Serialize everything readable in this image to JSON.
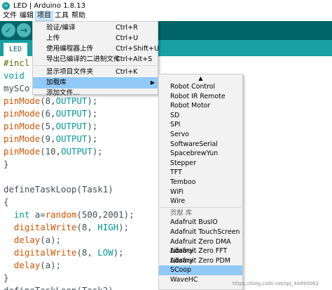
{
  "window": {
    "title": "LED | Arduino 1.8.13",
    "app_icon_glyph": "∞"
  },
  "menubar": {
    "items": [
      "文件",
      "编辑",
      "项目",
      "工具",
      "帮助"
    ],
    "active_index": 2
  },
  "toolbar": {
    "verify_glyph": "✓",
    "upload_glyph": "→"
  },
  "tabs": {
    "items": [
      "LED"
    ]
  },
  "editor": {
    "lines": [
      [
        {
          "t": "#incl",
          "c": "kw-pp"
        }
      ],
      [
        {
          "t": "void",
          "c": "kw-teal"
        }
      ],
      [
        {
          "t": "mySCo",
          "c": ""
        }
      ],
      [
        {
          "t": "pinMode",
          "c": "kw-orange"
        },
        {
          "t": "(8,",
          "c": ""
        },
        {
          "t": "OUTPUT",
          "c": "kw-teal"
        },
        {
          "t": ");",
          "c": ""
        }
      ],
      [
        {
          "t": "pinMode",
          "c": "kw-orange"
        },
        {
          "t": "(6,",
          "c": ""
        },
        {
          "t": "OUTPUT",
          "c": "kw-teal"
        },
        {
          "t": ");",
          "c": ""
        }
      ],
      [
        {
          "t": "pinMode",
          "c": "kw-orange"
        },
        {
          "t": "(5,",
          "c": ""
        },
        {
          "t": "OUTPUT",
          "c": "kw-teal"
        },
        {
          "t": ");",
          "c": ""
        }
      ],
      [
        {
          "t": "pinMode",
          "c": "kw-orange"
        },
        {
          "t": "(9,",
          "c": ""
        },
        {
          "t": "OUTPUT",
          "c": "kw-teal"
        },
        {
          "t": ");",
          "c": ""
        }
      ],
      [
        {
          "t": "pinMode",
          "c": "kw-orange"
        },
        {
          "t": "(10,",
          "c": ""
        },
        {
          "t": "OUTPUT",
          "c": "kw-teal"
        },
        {
          "t": ");",
          "c": ""
        }
      ],
      [
        {
          "t": "}",
          "c": ""
        }
      ],
      [
        {
          "t": "",
          "c": ""
        }
      ],
      [
        {
          "t": "defineTaskLoop(Task1)",
          "c": ""
        }
      ],
      [
        {
          "t": "{",
          "c": ""
        }
      ],
      [
        {
          "t": "  ",
          "c": ""
        },
        {
          "t": "int",
          "c": "kw-teal"
        },
        {
          "t": " a=",
          "c": ""
        },
        {
          "t": "random",
          "c": "kw-orange"
        },
        {
          "t": "(500,2001);",
          "c": ""
        }
      ],
      [
        {
          "t": "  ",
          "c": ""
        },
        {
          "t": "digitalWrite",
          "c": "kw-orange"
        },
        {
          "t": "(8, ",
          "c": ""
        },
        {
          "t": "HIGH",
          "c": "kw-teal"
        },
        {
          "t": ");",
          "c": ""
        }
      ],
      [
        {
          "t": "  ",
          "c": ""
        },
        {
          "t": "delay",
          "c": "kw-orange"
        },
        {
          "t": "(a);",
          "c": ""
        }
      ],
      [
        {
          "t": "  ",
          "c": ""
        },
        {
          "t": "digitalWrite",
          "c": "kw-orange"
        },
        {
          "t": "(8, ",
          "c": ""
        },
        {
          "t": "LOW",
          "c": "kw-teal"
        },
        {
          "t": ");",
          "c": ""
        }
      ],
      [
        {
          "t": "  ",
          "c": ""
        },
        {
          "t": "delay",
          "c": "kw-orange"
        },
        {
          "t": "(a);",
          "c": ""
        }
      ],
      [
        {
          "t": "}",
          "c": ""
        }
      ],
      [
        {
          "t": "defineTaskLoop(Task2)",
          "c": ""
        }
      ]
    ]
  },
  "project_menu": {
    "items": [
      {
        "label": "验证/编译",
        "shortcut": "Ctrl+R"
      },
      {
        "label": "上传",
        "shortcut": "Ctrl+U"
      },
      {
        "label": "使用编程器上传",
        "shortcut": "Ctrl+Shift+U"
      },
      {
        "label": "导出已编译的二进制文件",
        "shortcut": "Ctrl+Alt+S"
      },
      {
        "label": "显示项目文件夹",
        "shortcut": "Ctrl+K"
      },
      {
        "label": "加载库",
        "shortcut": "",
        "submenu": true,
        "highlighted": true
      },
      {
        "label": "添加文件...",
        "shortcut": ""
      }
    ],
    "submenu_arrow": "▶"
  },
  "library_submenu": {
    "scroll_up_glyph": "▲",
    "items": [
      {
        "label": "Robot Control"
      },
      {
        "label": "Robot IR Remote"
      },
      {
        "label": "Robot Motor"
      },
      {
        "label": "SD"
      },
      {
        "label": "SPI"
      },
      {
        "label": "Servo"
      },
      {
        "label": "SoftwareSerial"
      },
      {
        "label": "SpacebrewYun"
      },
      {
        "label": "Stepper"
      },
      {
        "label": "TFT"
      },
      {
        "label": "Temboo"
      },
      {
        "label": "WiFi"
      },
      {
        "label": "Wire"
      },
      {
        "label": "贡献 库",
        "header": true
      },
      {
        "label": "Adafruit BusIO"
      },
      {
        "label": "Adafruit TouchScreen"
      },
      {
        "label": "Adafruit Zero DMA Library"
      },
      {
        "label": "Adafruit Zero FFT Library"
      },
      {
        "label": "Adafruit Zero PDM Library"
      },
      {
        "label": "SCoop",
        "highlighted": true
      },
      {
        "label": "WaveHC"
      }
    ]
  },
  "watermark": "https://blog.csdn.net/qq_44890062"
}
